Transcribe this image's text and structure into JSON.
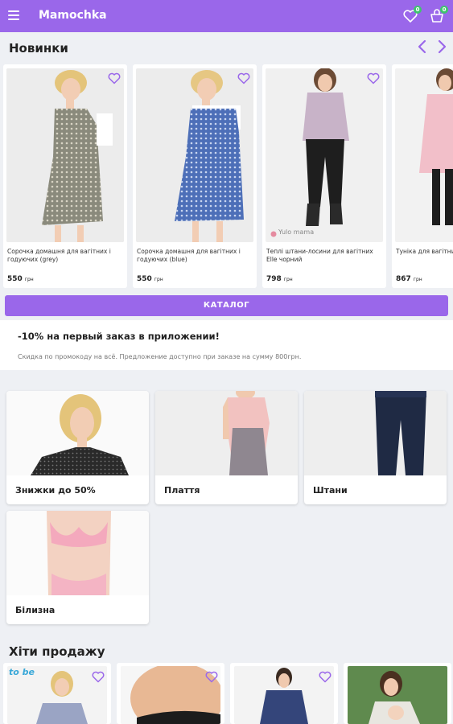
{
  "appbar": {
    "title": "Mamochka",
    "favorites_badge": "0",
    "cart_badge": "0"
  },
  "new_section": {
    "title": "Новинки",
    "products": [
      {
        "name": "Сорочка домашня для вагітних і годуючих (grey)",
        "price": "550",
        "currency": "грн"
      },
      {
        "name": "Сорочка домашня для вагітних і годуючих (blue)",
        "price": "550",
        "currency": "грн"
      },
      {
        "name": "Теплі штани-лосини для вагітних Elle чорний",
        "price": "798",
        "currency": "грн"
      },
      {
        "name": "Туніка для вагітних \"ніжний сезон\"",
        "price": "867",
        "currency": "грн"
      }
    ],
    "watermark": "Yulo mama"
  },
  "catalog_button": "КАТАЛОГ",
  "promo": {
    "title": "-10% на первый заказ в приложении!",
    "text": "Скидка по промокоду на всё. Предложение доступно при заказе на сумму 800грн."
  },
  "categories": [
    {
      "label": "Знижки до 50%"
    },
    {
      "label": "Плаття"
    },
    {
      "label": "Штани"
    },
    {
      "label": "Білизна"
    }
  ],
  "bestsellers": {
    "title": "Хіти продажу",
    "logo_text": "to be"
  },
  "colors": {
    "accent": "#9a67ea",
    "badge": "#3ec46d"
  }
}
